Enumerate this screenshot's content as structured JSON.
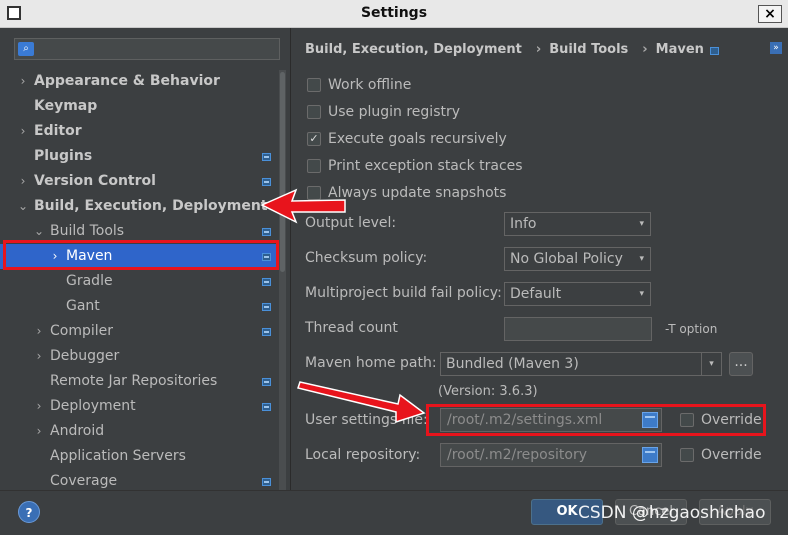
{
  "window": {
    "title": "Settings",
    "close_label": "×"
  },
  "search": {
    "placeholder": ""
  },
  "sidebar": {
    "items": [
      {
        "label": "Appearance & Behavior",
        "chevron": "›"
      },
      {
        "label": "Keymap"
      },
      {
        "label": "Editor",
        "chevron": "›"
      },
      {
        "label": "Plugins"
      },
      {
        "label": "Version Control",
        "chevron": "›"
      },
      {
        "label": "Build, Execution, Deployment",
        "chevron": "⌄"
      },
      {
        "label": "Build Tools",
        "chevron": "⌄"
      },
      {
        "label": "Maven",
        "chevron": "›"
      },
      {
        "label": "Gradle"
      },
      {
        "label": "Gant"
      },
      {
        "label": "Compiler",
        "chevron": "›"
      },
      {
        "label": "Debugger",
        "chevron": "›"
      },
      {
        "label": "Remote Jar Repositories"
      },
      {
        "label": "Deployment",
        "chevron": "›"
      },
      {
        "label": "Android",
        "chevron": "›"
      },
      {
        "label": "Application Servers"
      },
      {
        "label": "Coverage"
      }
    ]
  },
  "breadcrumb": {
    "part1": "Build, Execution, Deployment",
    "part2": "Build Tools",
    "part3": "Maven",
    "separator": "›",
    "expand_label": "»"
  },
  "options": {
    "work_offline": "Work offline",
    "use_plugin_registry": "Use plugin registry",
    "execute_goals_recursively": "Execute goals recursively",
    "print_stack_traces": "Print exception stack traces",
    "always_update_snapshots": "Always update snapshots",
    "checked_mark": "✓"
  },
  "form": {
    "output_level_label": "Output level:",
    "output_level_value": "Info",
    "checksum_label": "Checksum policy:",
    "checksum_value": "No Global Policy",
    "multiproject_label": "Multiproject build fail policy:",
    "multiproject_value": "Default",
    "thread_count_label": "Thread count",
    "thread_count_value": "",
    "thread_hint": "-T option",
    "maven_home_label": "Maven home path:",
    "maven_home_value": "Bundled (Maven 3)",
    "browse_label": "...",
    "version_text": "(Version: 3.6.3)",
    "user_settings_label": "User settings file:",
    "user_settings_value": "/root/.m2/settings.xml",
    "override_label": "Override",
    "local_repo_label": "Local repository:",
    "local_repo_value": "/root/.m2/repository",
    "override_label_2": "Override",
    "arrow_glyph": "▾"
  },
  "footer": {
    "help_label": "?",
    "ok_label": "OK",
    "cancel_label": "Cancel",
    "apply_label": "Apply",
    "watermark": "CSDN @hzgaoshichao"
  },
  "annotation_color": "#e8141c"
}
